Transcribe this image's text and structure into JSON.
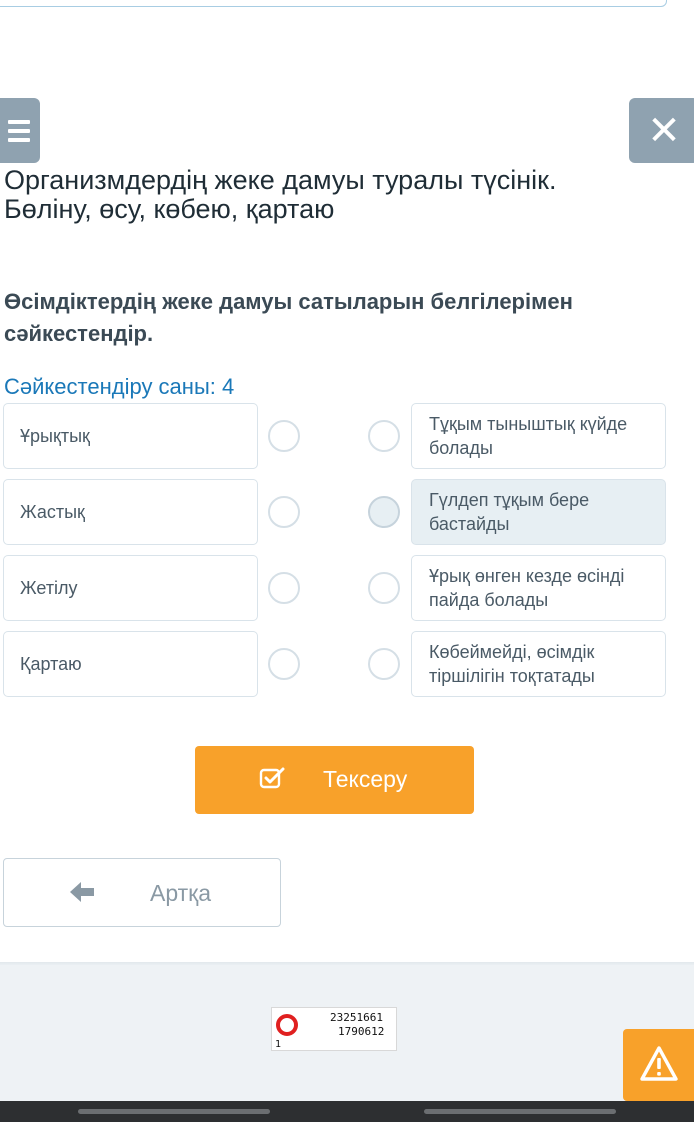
{
  "lesson": {
    "title_line1": "Организмдердің жеке дамуы туралы түсінік.",
    "title_line2": "Бөліну, өсу, көбею, қартаю"
  },
  "task": {
    "title_line1": "Өсімдіктердің жеке дамуы сатыларын белгілерімен",
    "title_line2": "сәйкестендір.",
    "match_count": "Сәйкестендіру саны: 4"
  },
  "left_items": [
    {
      "label": "Ұрықтық"
    },
    {
      "label": "Жастық"
    },
    {
      "label": "Жетілу"
    },
    {
      "label": "Қартаю"
    }
  ],
  "right_items": [
    {
      "line1": "Тұқым тыныштық күйде",
      "line2": "болады"
    },
    {
      "line1": "Гүлдеп тұқым бере",
      "line2": "бастайды",
      "selected": true
    },
    {
      "line1": "Ұрық өнген кезде өсінді",
      "line2": "пайда болады"
    },
    {
      "line1": "Көбеймейді, өсімдік",
      "line2": "тіршілігін тоқтатады"
    }
  ],
  "buttons": {
    "check_label": "Тексеру",
    "back_label": "Артқа"
  },
  "counter": {
    "line1": "23251661",
    "line2": "1790612",
    "index": "1"
  },
  "colors": {
    "accent_orange": "#f8a12a",
    "link_blue": "#1a78b8",
    "header_button_gray": "#8fa2b0",
    "highlight": "#e7eff3"
  },
  "icons": {
    "menu": "hamburger-icon",
    "close": "close-icon",
    "check": "check-square-icon",
    "back": "arrow-left-icon",
    "report": "warning-icon"
  }
}
